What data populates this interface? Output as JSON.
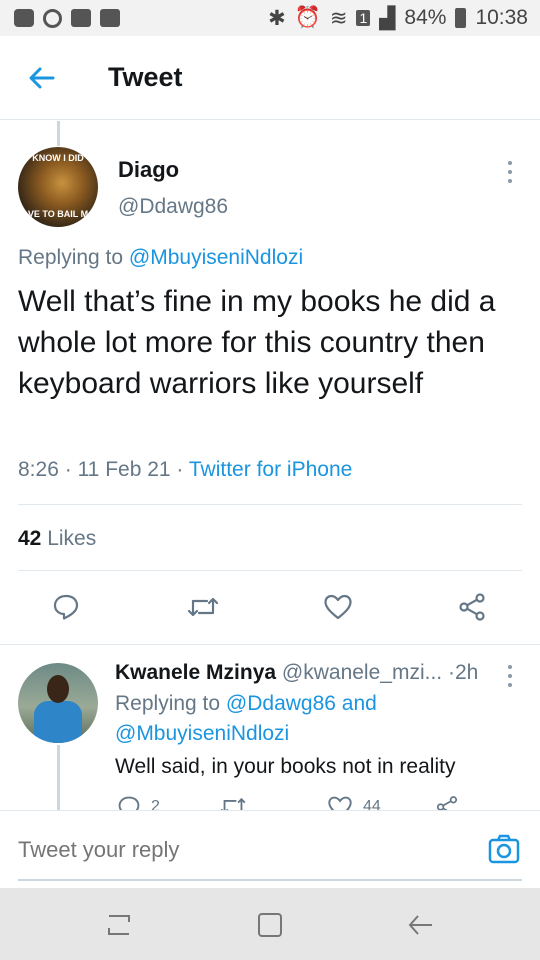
{
  "status_bar": {
    "battery": "84%",
    "time": "10:38",
    "sim_badge": "1"
  },
  "header": {
    "title": "Tweet"
  },
  "tweet": {
    "avatar_caption_top": "KNOW I DID",
    "avatar_caption_bottom": "VE TO BAIL M",
    "name": "Diago",
    "handle": "@Ddawg86",
    "replying_prefix": "Replying to",
    "replying_to": "@MbuyiseniNdlozi",
    "text": "Well that’s fine in my books he did a whole lot more for this country then keyboard warriors like yourself",
    "time": "8:26",
    "date": "11 Feb 21",
    "sep": "·",
    "source": "Twitter for iPhone",
    "likes_count": "42",
    "likes_label": "Likes"
  },
  "reply": {
    "name": "Kwanele Mzinya",
    "handle": "@kwanele_mzi...",
    "sep": "·",
    "time": "2h",
    "replying_prefix": "Replying to",
    "replying_to_1": "@Ddawg86",
    "and": "and",
    "replying_to_2": "@MbuyiseniNdlozi",
    "text": "Well said, in your books not in reality",
    "reply_count": "2",
    "like_count": "44"
  },
  "reply_bar": {
    "placeholder": "Tweet your reply"
  },
  "colors": {
    "accent": "#1b95e0",
    "secondary_text": "#657786",
    "divider": "#e1e8ed"
  }
}
